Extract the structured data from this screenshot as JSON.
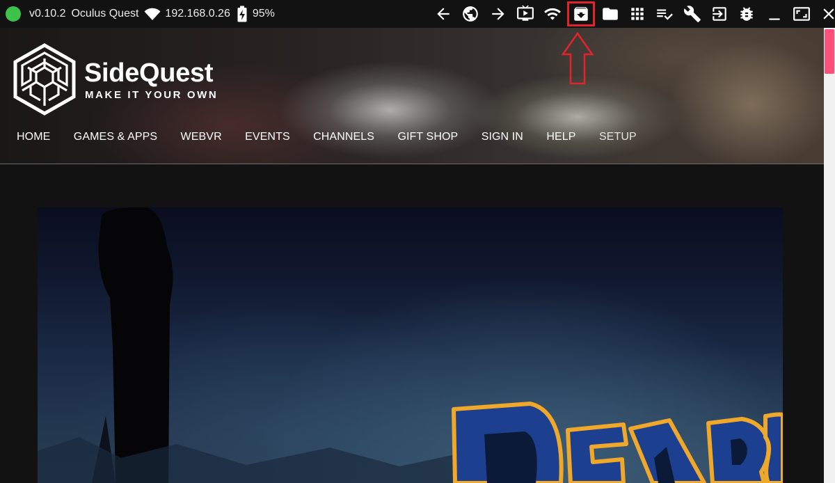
{
  "status": {
    "version": "v0.10.2",
    "device": "Oculus Quest",
    "ip": "192.168.0.26",
    "battery": "95%",
    "connected_color": "#3ec34a"
  },
  "toolbar": {
    "icons": [
      "arrow-left-icon",
      "globe-icon",
      "arrow-right-icon",
      "tv-play-icon",
      "wifi-icon",
      "archive-download-icon",
      "folder-icon",
      "apps-grid-icon",
      "playlist-check-icon",
      "wrench-icon",
      "exit-to-app-icon",
      "bug-icon",
      "minimize-icon",
      "maximize-icon",
      "close-icon"
    ],
    "highlighted": "archive-download-icon",
    "highlight_color": "#e0242b"
  },
  "site": {
    "brand": "SideQuest",
    "tagline": "MAKE IT YOUR OWN",
    "nav": [
      "HOME",
      "GAMES & APPS",
      "WEBVR",
      "EVENTS",
      "CHANNELS",
      "GIFT SHOP",
      "SIGN IN",
      "HELP",
      "SETUP"
    ]
  },
  "scrollbar_color": "#ff4f7b"
}
